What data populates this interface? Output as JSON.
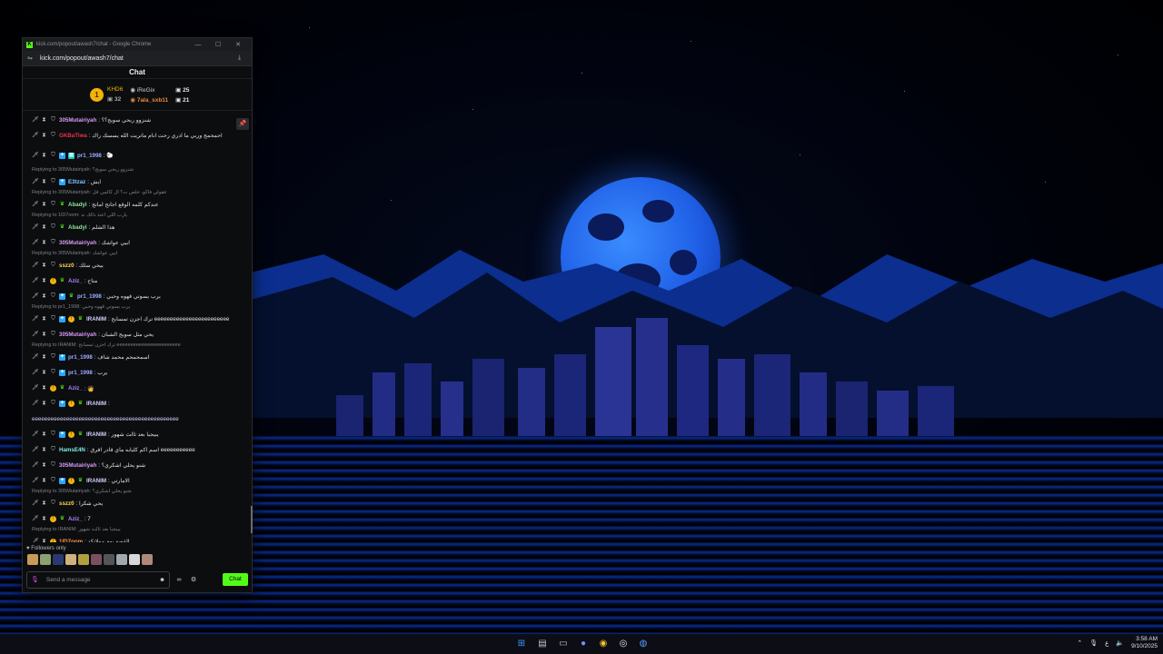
{
  "browser": {
    "window_title": "kick.com/popout/awash7/chat - Google Chrome",
    "url": "kick.com/popout/awash7/chat",
    "brand_color": "#53fc18"
  },
  "chat": {
    "header": "Chat",
    "leaderboard": {
      "rank": "1",
      "entries": [
        {
          "name": "KHD6",
          "points": "32",
          "color": "#f2b20a"
        },
        {
          "name": "iReGix",
          "points": "25",
          "color": "#c9cbd0"
        },
        {
          "name": "7ala_sxb11",
          "points": "21",
          "color": "#e9883a"
        }
      ]
    },
    "messages": [
      {
        "reply": "",
        "user": "305Mutairiyah",
        "color": "#d79cf5",
        "text": ": شنزوو ريحي سويج؟؟",
        "badges": [
          "sw",
          "hg",
          "sh"
        ]
      },
      {
        "reply": "",
        "user": "GKBaTiwa",
        "color": "#e8324e",
        "text": ": احمحمج وربي ما ادري رحت انام ماتريت الله يسسك راك",
        "badges": [
          "sw",
          "hg",
          "sh"
        ]
      },
      {
        "reply": "",
        "user": "pr1_1998",
        "color": "#9aa9ff",
        "text": ": 🐑",
        "badges": [
          "sw",
          "hg",
          "sh",
          "sb",
          "tt"
        ],
        "tall": true
      },
      {
        "reply": "Replying to 305Mutairiyah: شنزوو ريحي سويج؟",
        "user": "E3tzaz",
        "color": "#7ec6ff",
        "text": ": ايش",
        "badges": [
          "sw",
          "hg",
          "sh",
          "sb"
        ]
      },
      {
        "reply": "Replying to 305Mutairiyah: عقولي فاكو، خلص ت؟ ال كالمي قل",
        "user": "Abadyi",
        "color": "#8fe29a",
        "text": ": عندكم كلمه الوقع اجانح امانج",
        "badges": [
          "sw",
          "hg",
          "sh",
          "gm"
        ]
      },
      {
        "reply": "Replying to 1lD7oom: يارب اللي اعتذ دالك ند",
        "user": "Abadyi",
        "color": "#8fe29a",
        "text": ": هذا الشلم",
        "badges": [
          "sw",
          "hg",
          "sh",
          "gm"
        ]
      },
      {
        "reply": "",
        "user": "305Mutairiyah",
        "color": "#d79cf5",
        "text": ": ابيي عواشك",
        "badges": [
          "sw",
          "hg",
          "sh"
        ]
      },
      {
        "reply": "Replying to 305Mutairiyah: ابيي عواشك",
        "user": "sszz0",
        "color": "#ffd65a",
        "text": ": بيحي سلك",
        "badges": [
          "sw",
          "hg",
          "sh"
        ]
      },
      {
        "reply": "",
        "user": "Aziz_",
        "color": "#b07cff",
        "text": ": متاح",
        "badges": [
          "sw",
          "hg",
          "co",
          "gm"
        ]
      },
      {
        "reply": "",
        "user": "pr1_1998",
        "color": "#9aa9ff",
        "text": ": يرب يسوتي قهوه وحبي",
        "badges": [
          "sw",
          "hg",
          "sh",
          "sb",
          "gm"
        ]
      },
      {
        "reply": "Replying to pr1_1998: يرب بسوتي قهوه وحبي",
        "user": "IRANIM",
        "color": "#cfd1ff",
        "text": ": ترك اجزن تمسابح eeeeeeeeeeeeeeeeeeeeeeee",
        "badges": [
          "sw",
          "hg",
          "sh",
          "sb",
          "co",
          "gm"
        ]
      },
      {
        "reply": "",
        "user": "305Mutairiyah",
        "color": "#d79cf5",
        "text": ": يحي مثل سويج الشبان",
        "badges": [
          "sw",
          "hg",
          "sh"
        ]
      },
      {
        "reply": "Replying to IRANIM: ترك اجزن تمسابح eeeeeeeeeeeeeeeeeeeeeee",
        "user": "pr1_1998",
        "color": "#9aa9ff",
        "text": ": اسمحمحم محمد شاف",
        "badges": [
          "sw",
          "hg",
          "sh",
          "sb"
        ]
      },
      {
        "reply": "",
        "user": "pr1_1998",
        "color": "#9aa9ff",
        "text": ": يرب",
        "badges": [
          "sw",
          "hg",
          "sh",
          "sb"
        ]
      },
      {
        "reply": "",
        "user": "Aziz_",
        "color": "#b07cff",
        "text": ": 🧑",
        "badges": [
          "sw",
          "hg",
          "co",
          "gm"
        ]
      },
      {
        "reply": "",
        "user": "IRANIM",
        "color": "#cfd1ff",
        "text": ":",
        "badges": [
          "sw",
          "hg",
          "sh",
          "sb",
          "co",
          "gm"
        ]
      },
      {
        "reply": "",
        "user": "",
        "color": "#cfd1ff",
        "text": "eeeeeeeeeeeeeeeeeeeeeeeeeeeeeeeeeeeeeeeeeeeeeee",
        "badges": []
      },
      {
        "reply": "",
        "user": "IRANIM",
        "color": "#cfd1ff",
        "text": ": يبيجيا بعد ثالث شهور",
        "badges": [
          "sw",
          "hg",
          "sh",
          "sb",
          "co",
          "gm"
        ]
      },
      {
        "reply": "",
        "user": "HamsE4N",
        "color": "#7fe8e0",
        "text": ": اسم اكم كلبابه ماي قادر اقرق eeeeeeeeeee",
        "badges": [
          "sw",
          "hg",
          "sh"
        ]
      },
      {
        "reply": "",
        "user": "305Mutairiyah",
        "color": "#d79cf5",
        "text": ": شنو يحلي اشكري؟",
        "badges": [
          "sw",
          "hg",
          "sh"
        ]
      },
      {
        "reply": "",
        "user": "IRANIM",
        "color": "#cfd1ff",
        "text": ": الامارتي",
        "badges": [
          "sw",
          "hg",
          "sh",
          "sb",
          "co",
          "gm"
        ]
      },
      {
        "reply": "Replying to 305Mutairiyah: شنو يحلي اشكري؟",
        "user": "sszz0",
        "color": "#ffd65a",
        "text": ": يحي شكرا",
        "badges": [
          "sw",
          "hg",
          "sh"
        ]
      },
      {
        "reply": "",
        "user": "Aziz_",
        "color": "#b07cff",
        "text": ": 7",
        "badges": [
          "sw",
          "hg",
          "co",
          "gm"
        ]
      },
      {
        "reply": "Replying to IRANIM: يبيجيا بعد ثالث شهور",
        "user": "1lD7oom",
        "color": "#ff9a4a",
        "text": ": القصه يوم مولاتكد",
        "badges": [
          "sw",
          "hg",
          "co"
        ]
      }
    ],
    "followers_label": "Followers only",
    "input_placeholder": "Send a message",
    "chat_button": "Chat"
  },
  "taskbar": {
    "time": "3:58 AM",
    "date": "9/10/2025",
    "lang": "ع"
  }
}
